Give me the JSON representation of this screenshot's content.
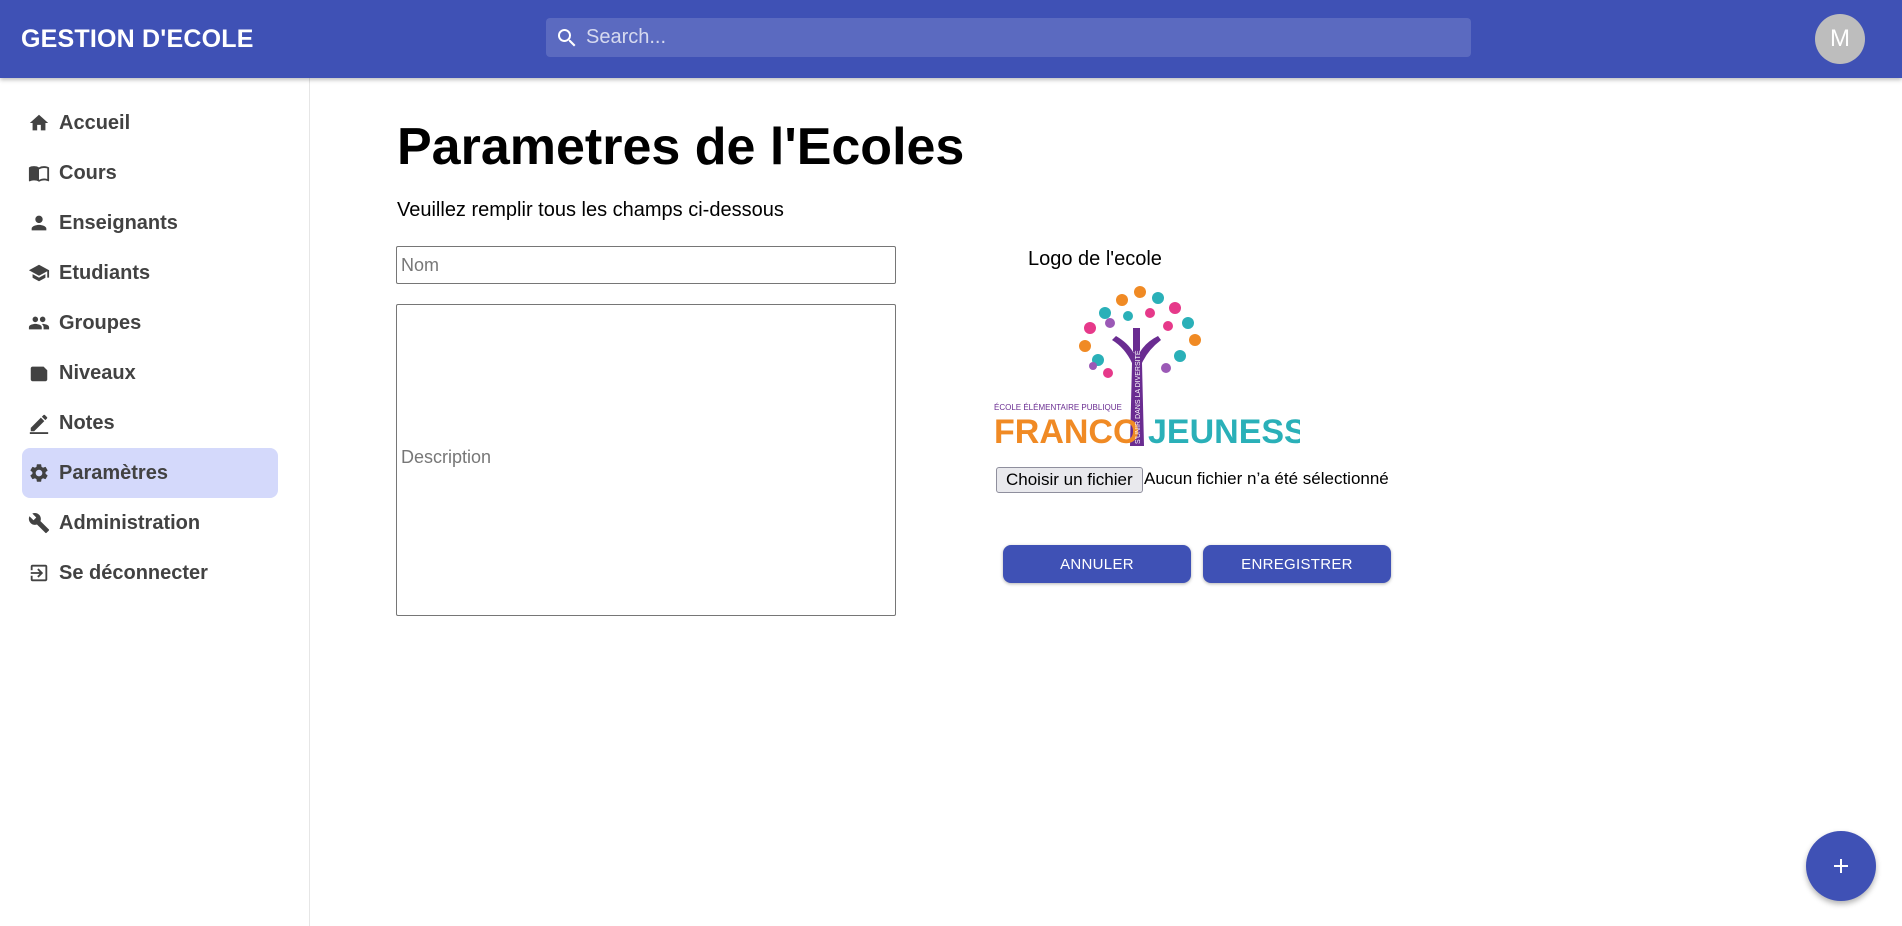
{
  "app": {
    "title": "GESTION D'ECOLE"
  },
  "search": {
    "placeholder": "Search...",
    "icon": "search-icon"
  },
  "user": {
    "avatar_initial": "M"
  },
  "colors": {
    "primary": "#3f51b5",
    "active_nav": "#d4d9fb"
  },
  "sidebar": {
    "items": [
      {
        "label": "Accueil",
        "icon": "home-icon",
        "active": false
      },
      {
        "label": "Cours",
        "icon": "book-icon",
        "active": false
      },
      {
        "label": "Enseignants",
        "icon": "person-icon",
        "active": false
      },
      {
        "label": "Etudiants",
        "icon": "school-icon",
        "active": false
      },
      {
        "label": "Groupes",
        "icon": "group-icon",
        "active": false
      },
      {
        "label": "Niveaux",
        "icon": "label-icon",
        "active": false
      },
      {
        "label": "Notes",
        "icon": "edit-icon",
        "active": false
      },
      {
        "label": "Paramètres",
        "icon": "gear-icon",
        "active": true
      },
      {
        "label": "Administration",
        "icon": "wrench-icon",
        "active": false
      },
      {
        "label": "Se déconnecter",
        "icon": "logout-icon",
        "active": false
      }
    ]
  },
  "main": {
    "title": "Parametres de l'Ecoles",
    "subtitle": "Veuillez remplir tous les champs ci-dessous",
    "nom_placeholder": "Nom",
    "nom_value": "",
    "description_placeholder": "Description",
    "description_value": "",
    "logo": {
      "label": "Logo de l'ecole",
      "image_text_top": "ÉCOLE ÉLÉMENTAIRE PUBLIQUE",
      "image_text_left": "FRANCO",
      "image_text_right": "JEUNESSE",
      "image_text_trunk": "S'UNIR DANS LA DIVERSITÉ"
    },
    "file": {
      "button_label": "Choisir un fichier",
      "status": "Aucun fichier n’a été sélectionné"
    },
    "buttons": {
      "cancel": "ANNULER",
      "save": "ENREGISTRER"
    }
  },
  "fab": {
    "icon": "plus-icon"
  }
}
